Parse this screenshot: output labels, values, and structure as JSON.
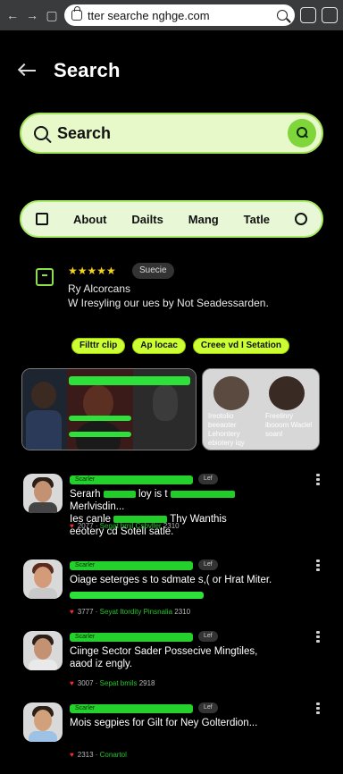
{
  "browser": {
    "url_text": "tter searche nghge.com"
  },
  "header": {
    "title": "Search"
  },
  "search": {
    "label": "Search"
  },
  "categories": [
    "About",
    "Dailts",
    "Mang",
    "Tatle"
  ],
  "featured": {
    "stars": "★★★★★",
    "badge": "Suecie",
    "title": "Ry Alcorcans",
    "subtitle": "W Iresyling our ues by Not Seadessarden."
  },
  "chips": [
    "Filttr clip",
    "Ap locac",
    "Creee vd I Setation"
  ],
  "image_cards": {
    "left_caption": "",
    "right_caption_1": "Ireotolio beeaoter Lehontery ebiotery iqy",
    "right_caption_2": "Freelinry ibooom Waclel soanl"
  },
  "list": [
    {
      "tag": "Scarler",
      "badge": "Lef",
      "title": "Serarh [green] loy is t [green] Merlvisdin... Ies canle [green] Thy Wanthis eeotery cd Sotell satle.",
      "title_lines": [
        "Serarh",
        "loy is t",
        "Merlvisdin...",
        "Ies canle",
        "Thy Wanthis",
        "eeotery cd Sotell satle."
      ],
      "meta_a": "2077",
      "meta_b": "Segat bmil Csbvller",
      "meta_c": "2310"
    },
    {
      "tag": "Scarler",
      "badge": "Lef",
      "title_lines": [
        "Oiage seterges s to sdmate s,( or Hrat Miter."
      ],
      "meta_a": "3777",
      "meta_b": "Seyat Itordity Pinsnalia",
      "meta_c": "2310"
    },
    {
      "tag": "Scarler",
      "badge": "Lef",
      "title_lines": [
        "Ciinge Sector Sader Possecive Mingtiles,",
        "aaod iz engly."
      ],
      "meta_a": "3007",
      "meta_b": "Sepat bmils",
      "meta_c": "2918"
    },
    {
      "tag": "Scarler",
      "badge": "Lef",
      "title_lines": [
        "Mois segpies for Gilt for Ney Golterdion..."
      ],
      "meta_a": "2313",
      "meta_b": "Conartol",
      "meta_c": ""
    }
  ]
}
